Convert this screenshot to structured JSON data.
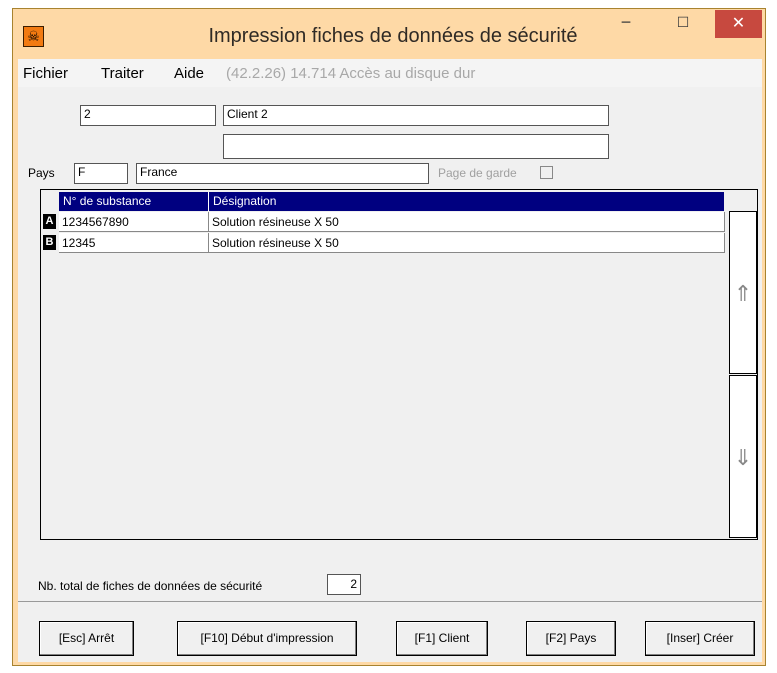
{
  "window": {
    "title": "Impression fiches de données de sécurité",
    "app_icon": "hazard-skull-icon",
    "minimize_glyph": "−",
    "maximize_glyph": "☐",
    "close_glyph": "✕"
  },
  "menu": {
    "fichier": "Fichier",
    "traiter": "Traiter",
    "aide": "Aide",
    "info": "(42.2.26) 14.714 Accès au disque dur"
  },
  "form": {
    "client_code": "2",
    "client_name": "Client 2",
    "client_name2": "",
    "pays_label": "Pays",
    "pays_code": "F",
    "pays_name": "France",
    "page_garde_label": "Page de garde",
    "page_garde_checked": false
  },
  "grid": {
    "columns": [
      "N° de substance",
      "Désignation"
    ],
    "rows": [
      {
        "letter": "A",
        "substance": "1234567890",
        "designation": "Solution résineuse X 50"
      },
      {
        "letter": "B",
        "substance": "12345",
        "designation": "Solution résineuse X 50"
      }
    ],
    "scroll_up_glyph": "⇑",
    "scroll_down_glyph": "⇓"
  },
  "totals": {
    "label": "Nb. total de fiches de données de sécurité",
    "value": "2"
  },
  "buttons": {
    "stop": "[Esc] Arrêt",
    "print": "[F10] Début d'impression",
    "client": "[F1] Client",
    "pays": "[F2] Pays",
    "create": "[Inser] Créer"
  },
  "colors": {
    "titlebar": "#fed9a6",
    "close_button": "#c7493f",
    "grid_header": "#000080"
  }
}
